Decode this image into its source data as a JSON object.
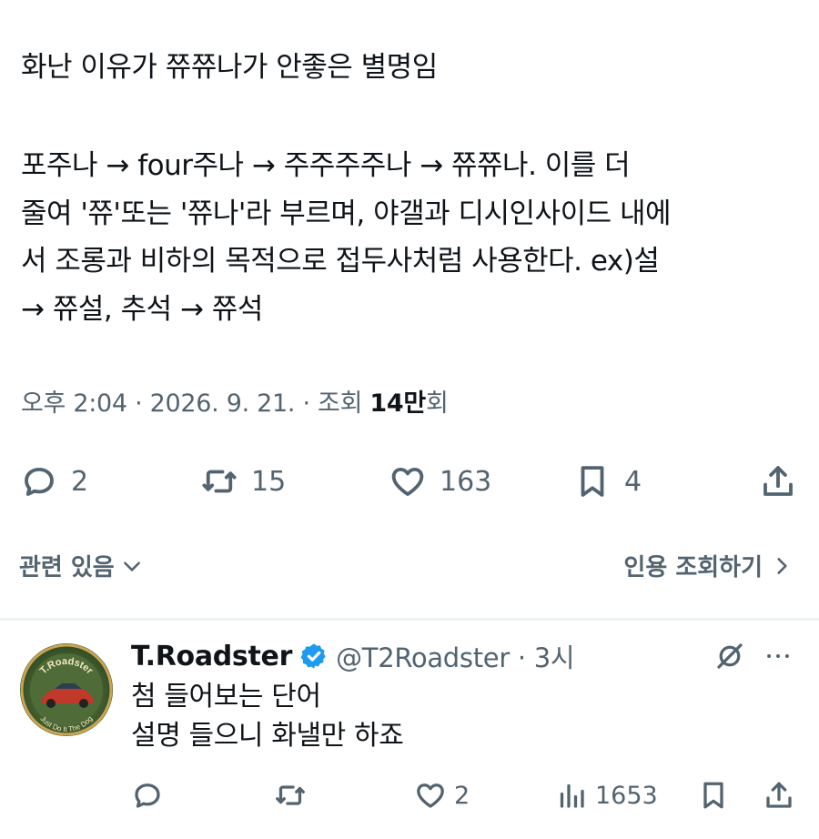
{
  "tweet": {
    "title": "화난 이유가 쮸쮸나가 안좋은 별명임",
    "body": "포주나 → four주나 → 주주주주나 → 쮸쮸나. 이를 더\n줄여 '쮸'또는 '쮸나'라 부르며, 야갤과 디시인사이드 내에\n서 조롱과 비하의 목적으로 접두사처럼 사용한다. ex)설\n→ 쮸설, 추석 → 쮸석",
    "meta_prefix": "오후 2:04 · 2026. 9. 21. · 조회 ",
    "views": "14만",
    "meta_suffix": "회",
    "replies": "2",
    "retweets": "15",
    "likes": "163",
    "bookmarks": "4"
  },
  "related_label": "관련 있음",
  "quote_views_label": "인용 조회하기",
  "reply": {
    "display_name": "T.Roadster",
    "handle_time": "@T2Roadster · 3시",
    "line1": "첨 들어보는 단어",
    "line2": "설명 들으니 화낼만 하죠",
    "likes": "2",
    "views": "1653",
    "avatar_top_text": "T.Roadster",
    "avatar_bottom_text": "Just Do It The Dog"
  },
  "colors": {
    "text": "#0f1419",
    "secondary": "#536471",
    "verified": "#1d9bf0",
    "divider": "#eff3f4"
  },
  "icons": [
    "reply-icon",
    "retweet-icon",
    "like-icon",
    "bookmark-icon",
    "share-icon",
    "chevron-down-icon",
    "chevron-right-icon",
    "verified-icon",
    "grok-icon",
    "more-icon",
    "views-icon"
  ]
}
